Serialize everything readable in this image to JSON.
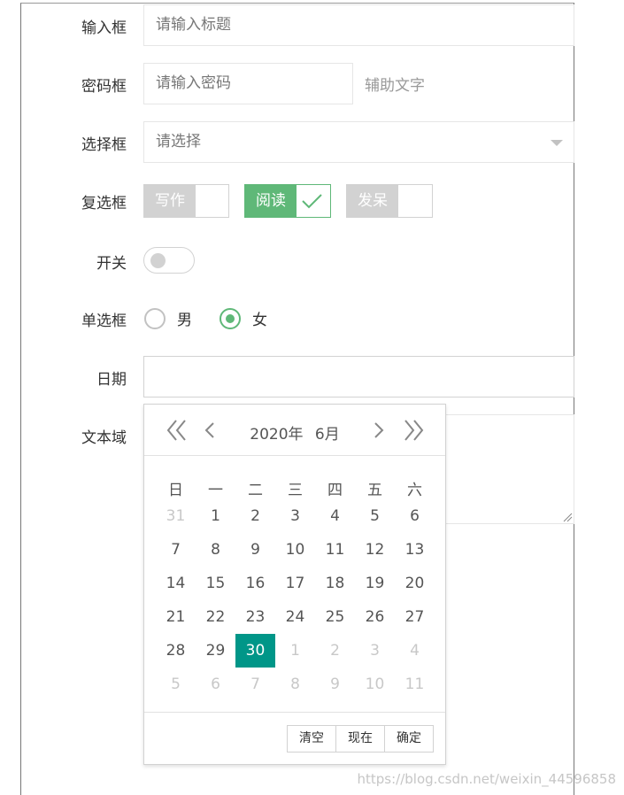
{
  "form": {
    "text_label": "输入框",
    "text_placeholder": "请输入标题",
    "password_label": "密码框",
    "password_placeholder": "请输入密码",
    "password_aux": "辅助文字",
    "select_label": "选择框",
    "select_value": "请选择",
    "checkbox_label": "复选框",
    "checkboxes": [
      {
        "text": "写作",
        "checked": false
      },
      {
        "text": "阅读",
        "checked": true
      },
      {
        "text": "发呆",
        "checked": false
      }
    ],
    "switch_label": "开关",
    "switch_on": false,
    "radio_label": "单选框",
    "radios": [
      {
        "text": "男",
        "checked": false
      },
      {
        "text": "女",
        "checked": true
      }
    ],
    "date_label": "日期",
    "date_value": "",
    "textarea_label": "文本域"
  },
  "calendar": {
    "year": "2020年",
    "month": "6月",
    "weekdays": [
      "日",
      "一",
      "二",
      "三",
      "四",
      "五",
      "六"
    ],
    "weeks": [
      [
        "31",
        "1",
        "2",
        "3",
        "4",
        "5",
        "6"
      ],
      [
        "7",
        "8",
        "9",
        "10",
        "11",
        "12",
        "13"
      ],
      [
        "14",
        "15",
        "16",
        "17",
        "18",
        "19",
        "20"
      ],
      [
        "21",
        "22",
        "23",
        "24",
        "25",
        "26",
        "27"
      ],
      [
        "28",
        "29",
        "30",
        "1",
        "2",
        "3",
        "4"
      ],
      [
        "5",
        "6",
        "7",
        "8",
        "9",
        "10",
        "11"
      ]
    ],
    "selected": "30",
    "buttons": {
      "clear": "清空",
      "now": "现在",
      "confirm": "确定"
    }
  },
  "colors": {
    "accent": "#5fb878",
    "selected": "#009688",
    "muted": "#d2d2d2"
  },
  "watermark": "https://blog.csdn.net/weixin_44596858"
}
